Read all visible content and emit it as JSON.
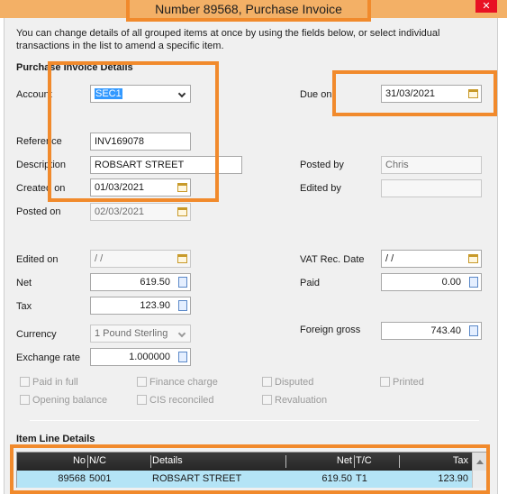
{
  "window": {
    "title": "Number 89568, Purchase Invoice",
    "close_label": "✕"
  },
  "intro_text": "You can change details of all grouped items at once by using the fields below, or select individual transactions in the list to amend a specific item.",
  "section_details": "Purchase Invoice Details",
  "fields": {
    "account": {
      "label": "Account",
      "value": "SEC1"
    },
    "due_on": {
      "label": "Due on",
      "value": "31/03/2021"
    },
    "reference": {
      "label": "Reference",
      "value": "INV169078"
    },
    "description": {
      "label": "Description",
      "value": "ROBSART STREET"
    },
    "posted_by": {
      "label": "Posted by",
      "value": "Chris"
    },
    "created_on": {
      "label": "Created on",
      "value": "01/03/2021"
    },
    "edited_by": {
      "label": "Edited by",
      "value": ""
    },
    "posted_on": {
      "label": "Posted on",
      "value": "02/03/2021"
    },
    "edited_on": {
      "label": "Edited on",
      "value": " / /"
    },
    "vat_rec_date": {
      "label": "VAT Rec. Date",
      "value": " / /"
    },
    "net": {
      "label": "Net",
      "value": "619.50"
    },
    "paid": {
      "label": "Paid",
      "value": "0.00"
    },
    "tax": {
      "label": "Tax",
      "value": "123.90"
    },
    "currency": {
      "label": "Currency",
      "value": "1  Pound Sterling"
    },
    "foreign_gross": {
      "label": "Foreign gross",
      "value": "743.40"
    },
    "exchange_rate": {
      "label": "Exchange rate",
      "value": "1.000000"
    }
  },
  "checkboxes": {
    "paid_in_full": "Paid in full",
    "finance_charge": "Finance charge",
    "disputed": "Disputed",
    "printed": "Printed",
    "opening_balance": "Opening balance",
    "cis_reconciled": "CIS reconciled",
    "revaluation": "Revaluation"
  },
  "section_items": "Item Line Details",
  "grid": {
    "headers": {
      "no": "No",
      "nc": "N/C",
      "details": "Details",
      "net": "Net",
      "tc": "T/C",
      "tax": "Tax"
    },
    "rows": [
      {
        "no": "89568",
        "nc": "5001",
        "details": "ROBSART STREET",
        "net": "619.50",
        "tc": "T1",
        "tax": "123.90"
      }
    ]
  },
  "colors": {
    "annotation": "#f18a2c",
    "selected_row": "#b4e4f6",
    "grid_header": "#2f2f2f",
    "close_button": "#e81123"
  },
  "icons": [
    "calendar-icon",
    "calculator-icon",
    "chevron-down-icon",
    "close-icon",
    "scroll-up-icon"
  ]
}
